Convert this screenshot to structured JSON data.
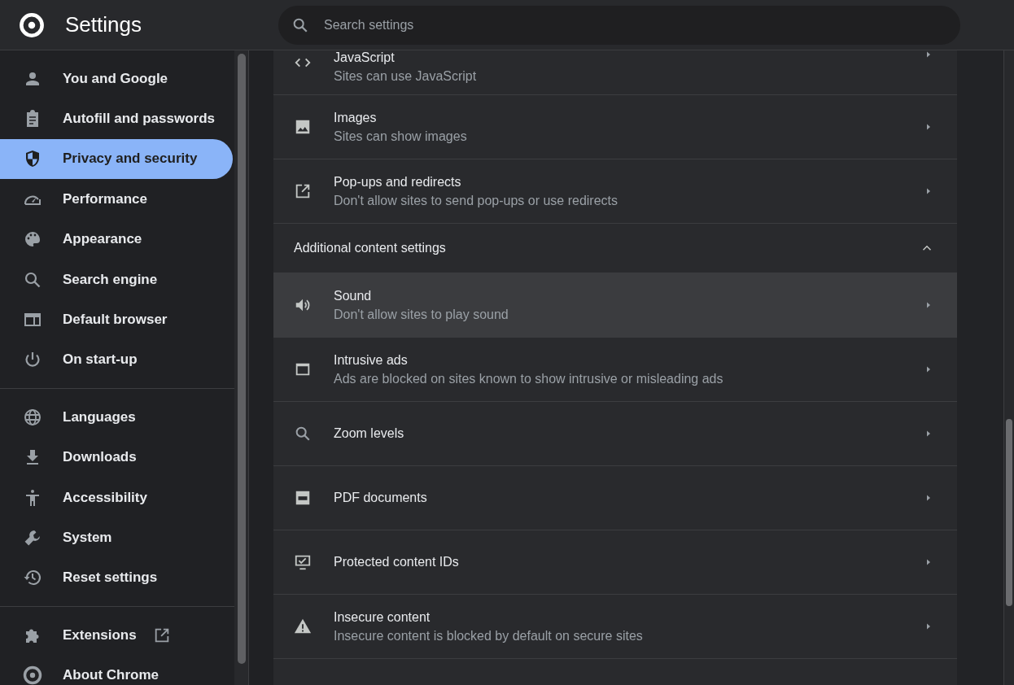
{
  "header": {
    "title": "Settings",
    "search": {
      "placeholder": "Search settings"
    }
  },
  "sidebar": {
    "groups": [
      {
        "items": [
          {
            "label": "You and Google",
            "selected": false
          },
          {
            "label": "Autofill and passwords",
            "selected": false
          },
          {
            "label": "Privacy and security",
            "selected": true
          },
          {
            "label": "Performance",
            "selected": false
          },
          {
            "label": "Appearance",
            "selected": false
          },
          {
            "label": "Search engine",
            "selected": false
          },
          {
            "label": "Default browser",
            "selected": false
          },
          {
            "label": "On start-up",
            "selected": false
          }
        ]
      },
      {
        "items": [
          {
            "label": "Languages",
            "selected": false
          },
          {
            "label": "Downloads",
            "selected": false
          },
          {
            "label": "Accessibility",
            "selected": false
          },
          {
            "label": "System",
            "selected": false
          },
          {
            "label": "Reset settings",
            "selected": false
          }
        ]
      },
      {
        "items": [
          {
            "label": "Extensions",
            "selected": false,
            "opens_externally": true
          },
          {
            "label": "About Chrome",
            "selected": false
          }
        ]
      }
    ]
  },
  "content": {
    "rows": [
      {
        "kind": "setting",
        "title": "JavaScript",
        "subtitle": "Sites can use JavaScript",
        "hovered": false
      },
      {
        "kind": "setting",
        "title": "Images",
        "subtitle": "Sites can show images",
        "hovered": false
      },
      {
        "kind": "setting",
        "title": "Pop-ups and redirects",
        "subtitle": "Don't allow sites to send pop-ups or use redirects",
        "hovered": false
      },
      {
        "kind": "section",
        "title": "Additional content settings",
        "expanded": true
      },
      {
        "kind": "setting",
        "title": "Sound",
        "subtitle": "Don't allow sites to play sound",
        "hovered": true
      },
      {
        "kind": "setting",
        "title": "Intrusive ads",
        "subtitle": "Ads are blocked on sites known to show intrusive or misleading ads",
        "hovered": false
      },
      {
        "kind": "setting",
        "title": "Zoom levels",
        "hovered": false
      },
      {
        "kind": "setting",
        "title": "PDF documents",
        "hovered": false
      },
      {
        "kind": "setting",
        "title": "Protected content IDs",
        "hovered": false
      },
      {
        "kind": "setting",
        "title": "Insecure content",
        "subtitle": "Insecure content is blocked by default on secure sites",
        "hovered": false
      }
    ]
  }
}
